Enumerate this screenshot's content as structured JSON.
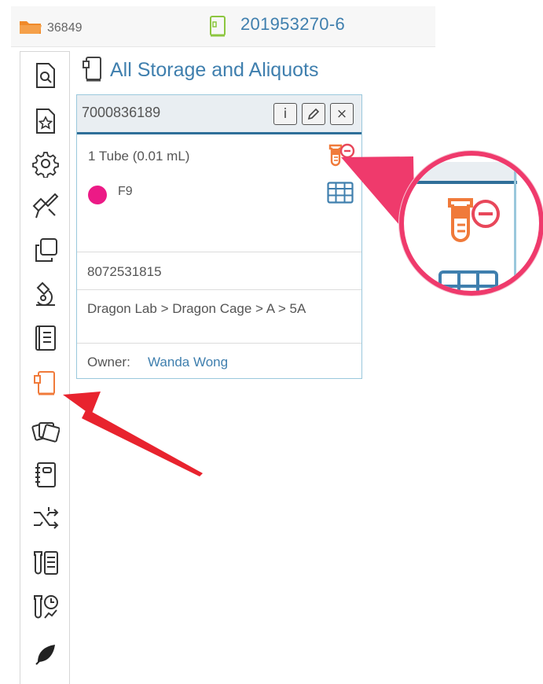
{
  "header": {
    "folder_number": "36849",
    "sample_id": "201953270-6"
  },
  "storage": {
    "title": "All Storage and Aliquots"
  },
  "card": {
    "id": "7000836189",
    "info_button": "i",
    "close_button": "×",
    "tube_text": "1 Tube (0.01 mL)",
    "position_label": "F9",
    "barcode": "8072531815",
    "location_path": "Dragon Lab > Dragon Cage > A > 5A",
    "owner_label": "Owner:",
    "owner_name": "Wanda Wong"
  },
  "colors": {
    "accent_blue": "#3f7fae",
    "highlight_red": "#ef3a6c",
    "tube_orange": "#f07a3a",
    "dot_pink": "#ec1a86",
    "folder_orange": "#f08a2a",
    "box_green": "#8cc63f"
  },
  "sidebar": {
    "items": [
      {
        "icon": "document-search-icon",
        "active": false
      },
      {
        "icon": "document-star-icon",
        "active": false
      },
      {
        "icon": "gear-icon",
        "active": false
      },
      {
        "icon": "pipette-icon",
        "active": false
      },
      {
        "icon": "copy-icon",
        "active": false
      },
      {
        "icon": "microscope-icon",
        "active": false
      },
      {
        "icon": "notebook-icon",
        "active": false
      },
      {
        "icon": "storage-box-icon",
        "active": true
      },
      {
        "icon": "photos-icon",
        "active": false
      },
      {
        "icon": "spiral-notebook-icon",
        "active": false
      },
      {
        "icon": "workflow-icon",
        "active": false
      },
      {
        "icon": "tube-list-icon",
        "active": false
      },
      {
        "icon": "tube-clock-icon",
        "active": false
      },
      {
        "icon": "leaf-icon",
        "active": false
      }
    ]
  }
}
